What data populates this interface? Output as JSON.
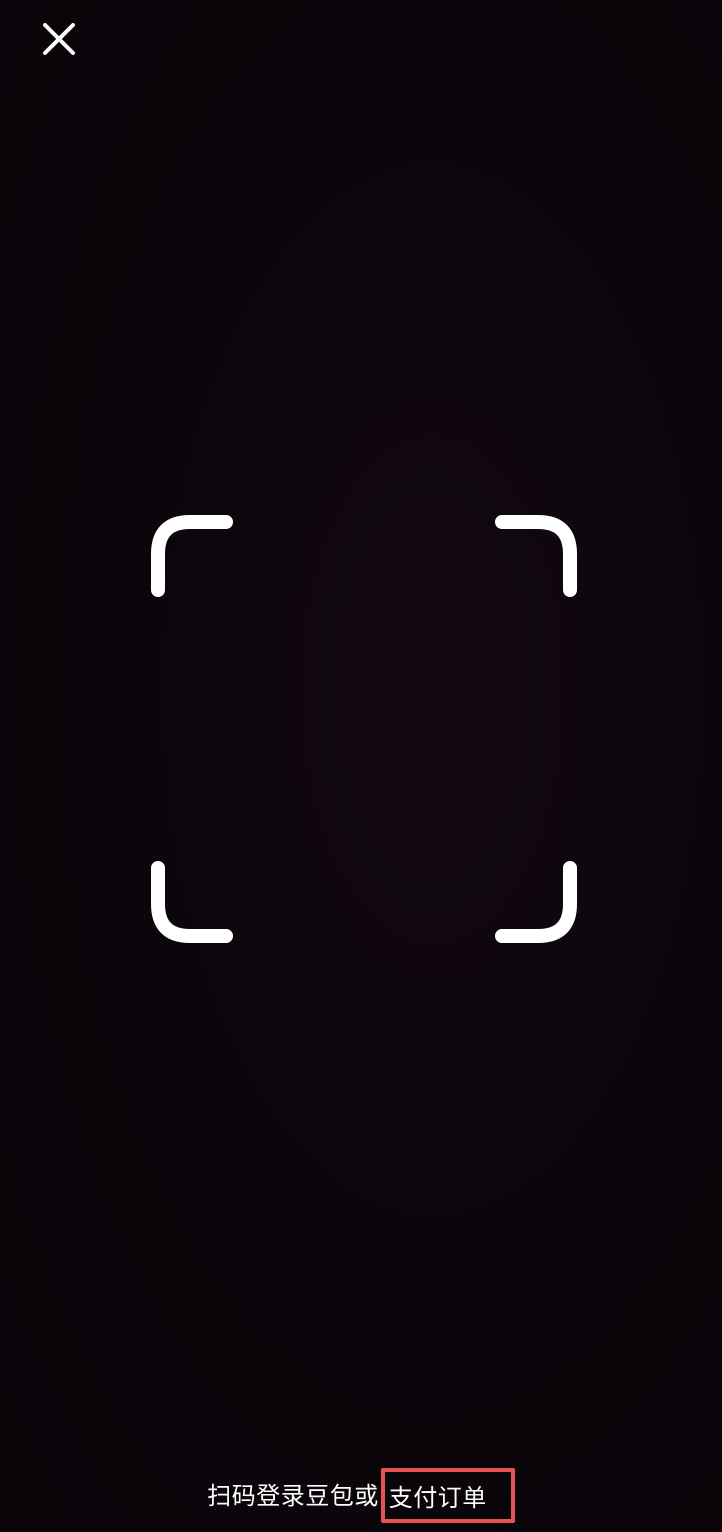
{
  "close": {
    "icon": "close-icon",
    "color": "#ffffff"
  },
  "scanner": {
    "frame_color": "#ffffff",
    "corner_icons": [
      "scan-corner-top-left-icon",
      "scan-corner-top-right-icon",
      "scan-corner-bottom-left-icon",
      "scan-corner-bottom-right-icon"
    ]
  },
  "hint": {
    "prefix": "扫码登录豆包或",
    "highlight": "支付订单",
    "highlight_border_color": "#e65353"
  }
}
